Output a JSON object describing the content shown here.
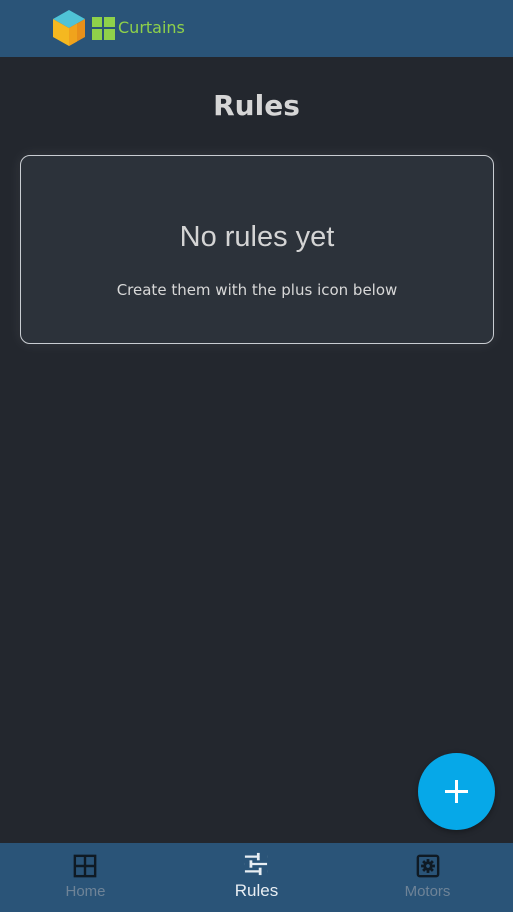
{
  "header": {
    "brand": "Curtains",
    "logo_icon": "cube-logo-icon",
    "grid_icon": "grid-logo-icon",
    "brand_color": "#8fd14a",
    "bar_color": "#2a5478"
  },
  "page": {
    "title": "Rules"
  },
  "empty_state": {
    "title": "No rules yet",
    "subtitle": "Create them with the plus icon below"
  },
  "fab": {
    "icon": "plus-icon",
    "color": "#06a8e8"
  },
  "nav": {
    "items": [
      {
        "label": "Home",
        "icon": "grid-icon",
        "active": false
      },
      {
        "label": "Rules",
        "icon": "sliders-icon",
        "active": true
      },
      {
        "label": "Motors",
        "icon": "gear-icon",
        "active": false
      }
    ]
  }
}
